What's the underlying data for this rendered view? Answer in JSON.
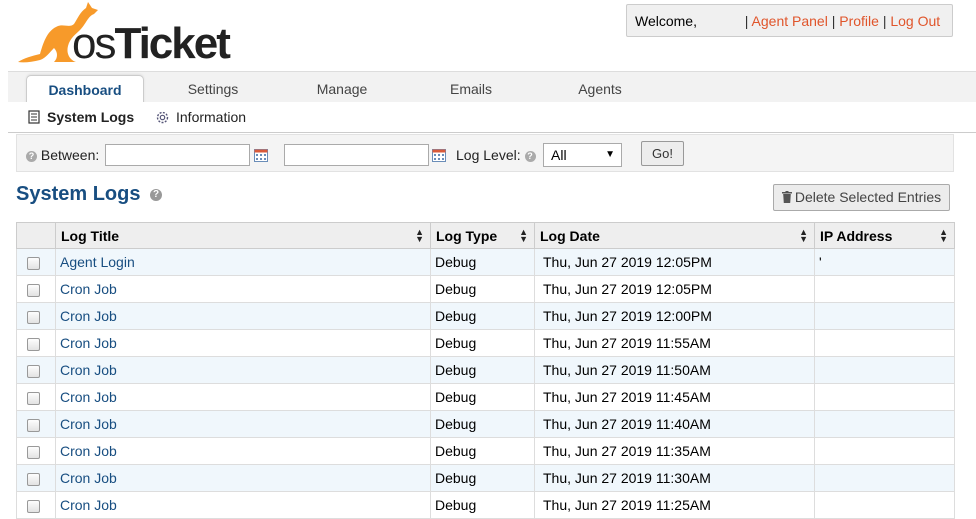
{
  "brand": {
    "logo_text_os": "os",
    "logo_text_ticket": "Ticket"
  },
  "userbox": {
    "welcome": "Welcome,",
    "username": "",
    "links": [
      "Agent Panel",
      "Profile",
      "Log Out"
    ],
    "separator": "|"
  },
  "nav": {
    "tabs": [
      {
        "label": "Dashboard",
        "active": true
      },
      {
        "label": "Settings",
        "active": false
      },
      {
        "label": "Manage",
        "active": false
      },
      {
        "label": "Emails",
        "active": false
      },
      {
        "label": "Agents",
        "active": false
      }
    ]
  },
  "subnav": {
    "items": [
      {
        "label": "System Logs",
        "icon": "document-icon",
        "active": true
      },
      {
        "label": "Information",
        "icon": "gear-icon",
        "active": false
      }
    ]
  },
  "filter": {
    "between_label": "Between:",
    "from_value": "",
    "to_value": "",
    "level_label": "Log Level:",
    "level_value": "All",
    "go_label": "Go!"
  },
  "page": {
    "title": "System Logs",
    "delete_label": "Delete Selected Entries"
  },
  "table": {
    "columns": [
      "Log Title",
      "Log Type",
      "Log Date",
      "IP Address"
    ],
    "rows": [
      {
        "title": "Agent Login",
        "type": "Debug",
        "date": "Thu, Jun 27 2019 12:05PM",
        "ip": "'"
      },
      {
        "title": "Cron Job",
        "type": "Debug",
        "date": "Thu, Jun 27 2019 12:05PM",
        "ip": ""
      },
      {
        "title": "Cron Job",
        "type": "Debug",
        "date": "Thu, Jun 27 2019 12:00PM",
        "ip": ""
      },
      {
        "title": "Cron Job",
        "type": "Debug",
        "date": "Thu, Jun 27 2019 11:55AM",
        "ip": ""
      },
      {
        "title": "Cron Job",
        "type": "Debug",
        "date": "Thu, Jun 27 2019 11:50AM",
        "ip": ""
      },
      {
        "title": "Cron Job",
        "type": "Debug",
        "date": "Thu, Jun 27 2019 11:45AM",
        "ip": ""
      },
      {
        "title": "Cron Job",
        "type": "Debug",
        "date": "Thu, Jun 27 2019 11:40AM",
        "ip": ""
      },
      {
        "title": "Cron Job",
        "type": "Debug",
        "date": "Thu, Jun 27 2019 11:35AM",
        "ip": ""
      },
      {
        "title": "Cron Job",
        "type": "Debug",
        "date": "Thu, Jun 27 2019 11:30AM",
        "ip": ""
      },
      {
        "title": "Cron Job",
        "type": "Debug",
        "date": "Thu, Jun 27 2019 11:25AM",
        "ip": ""
      }
    ]
  },
  "colors": {
    "accent": "#184e81",
    "link_orange": "#e0552b",
    "logo_orange": "#f79a2a",
    "row_alt": "#f0f7fc"
  }
}
